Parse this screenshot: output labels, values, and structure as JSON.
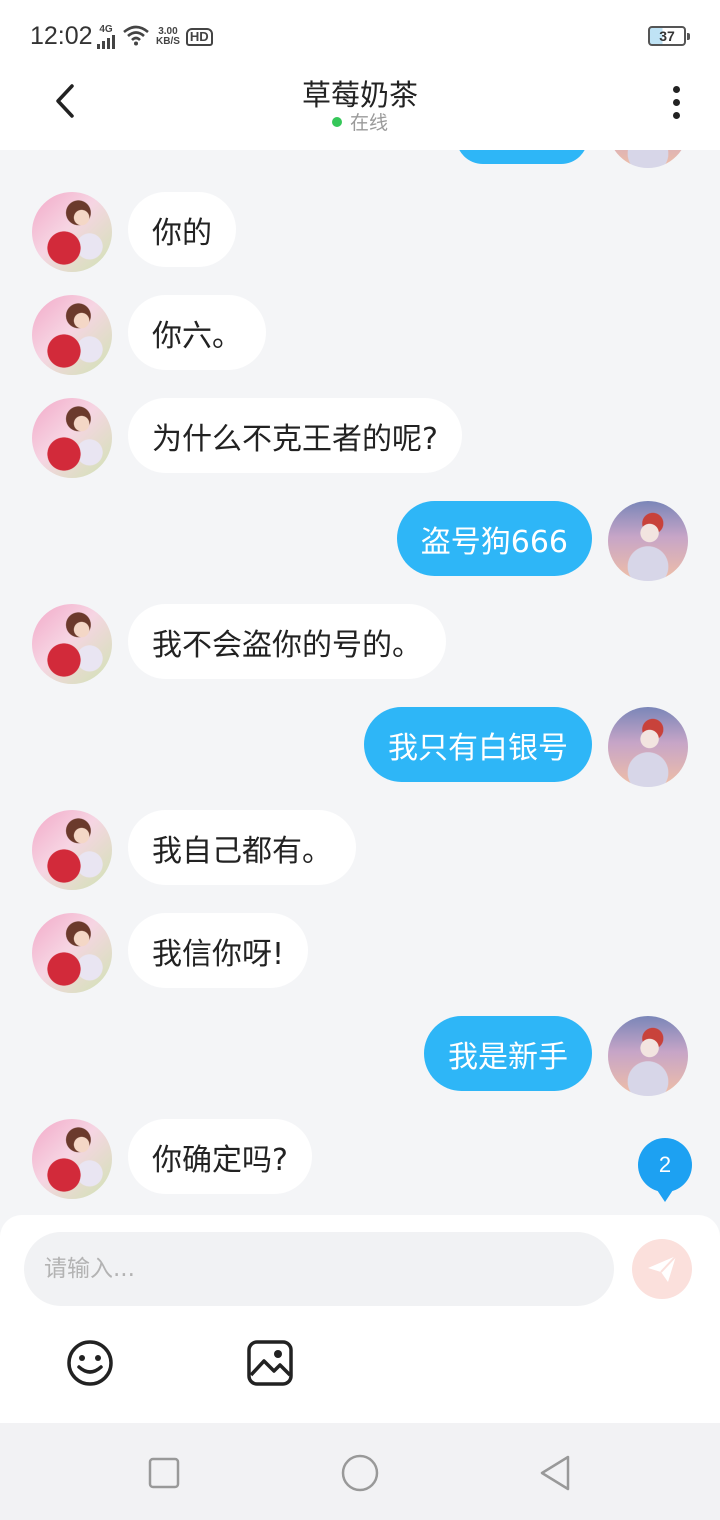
{
  "status_bar": {
    "time": "12:02",
    "network_type": "4G",
    "speed_value": "3.00",
    "speed_unit": "KB/S",
    "hd_label": "HD",
    "battery": "37"
  },
  "header": {
    "title": "草莓奶茶",
    "presence": "在线",
    "presence_color": "#35c759"
  },
  "messages": [
    {
      "side": "in",
      "text": "你的"
    },
    {
      "side": "in",
      "text": "你六。"
    },
    {
      "side": "in",
      "text": "为什么不克王者的呢?"
    },
    {
      "side": "out",
      "text": "盗号狗666"
    },
    {
      "side": "in",
      "text": "我不会盗你的号的。"
    },
    {
      "side": "out",
      "text": "我只有白银号"
    },
    {
      "side": "in",
      "text": "我自己都有。"
    },
    {
      "side": "in",
      "text": "我信你呀!"
    },
    {
      "side": "out",
      "text": "我是新手"
    },
    {
      "side": "in",
      "text": "你确定吗?"
    }
  ],
  "unread_count": "2",
  "composer": {
    "placeholder": "请输入..."
  },
  "colors": {
    "outgoing_bubble": "#2eb6f7",
    "incoming_bubble": "#ffffff",
    "badge": "#1da1f2",
    "send_button": "#fbe0dc"
  },
  "icons": {
    "back": "chevron-left-icon",
    "more": "more-vertical-icon",
    "send": "paper-plane-icon",
    "emoji": "smiley-icon",
    "image": "image-icon",
    "nav_recents": "square-icon",
    "nav_home": "circle-icon",
    "nav_back": "triangle-back-icon"
  }
}
